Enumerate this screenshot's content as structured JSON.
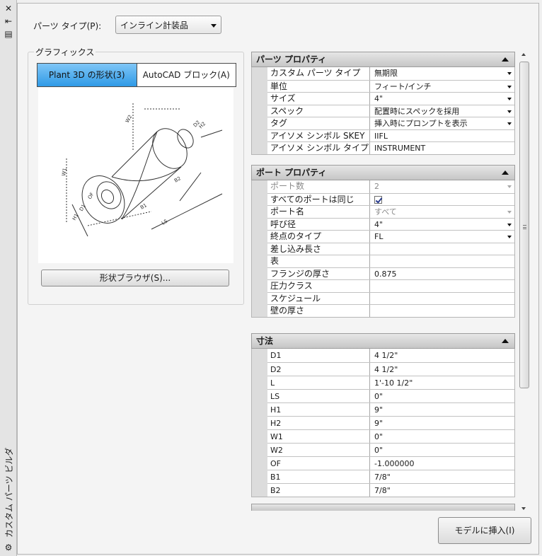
{
  "palette": {
    "title": "カスタム パーツ ビルダ"
  },
  "parts_type": {
    "label": "パーツ タイプ(P):",
    "value": "インライン計装品"
  },
  "graphics": {
    "group_title": "グラフィックス",
    "tabs": [
      {
        "label": "Plant 3D の形状(3)",
        "active": true
      },
      {
        "label": "AutoCAD ブロック(A)",
        "active": false
      }
    ],
    "browse_button": "形状ブラウザ(S)...",
    "diagram_labels": [
      "W2",
      "D2",
      "H2",
      "B2",
      "W1",
      "OF",
      "D1",
      "H1",
      "B1",
      "LS"
    ]
  },
  "sections": {
    "part_props": {
      "title": "パーツ プロパティ",
      "rows": [
        {
          "name": "カスタム パーツ タイプ",
          "value": "無期限"
        },
        {
          "name": "単位",
          "value": "フィート/インチ"
        },
        {
          "name": "サイズ",
          "value": "4\""
        },
        {
          "name": "スペック",
          "value": "配置時にスペックを採用"
        },
        {
          "name": "タグ",
          "value": "挿入時にプロンプトを表示"
        },
        {
          "name": "アイソメ シンボル SKEY",
          "value": "IIFL"
        },
        {
          "name": "アイソメ シンボル タイプ",
          "value": "INSTRUMENT"
        }
      ]
    },
    "port_props": {
      "title": "ポート プロパティ",
      "rows": [
        {
          "name": "ポート数",
          "value": "2"
        },
        {
          "name": "すべてのポートは同じ",
          "value": ""
        },
        {
          "name": "ポート名",
          "value": "すべて"
        },
        {
          "name": "呼び径",
          "value": "4\""
        },
        {
          "name": "終点のタイプ",
          "value": "FL"
        },
        {
          "name": "差し込み長さ",
          "value": ""
        },
        {
          "name": "表",
          "value": ""
        },
        {
          "name": "フランジの厚さ",
          "value": "0.875"
        },
        {
          "name": "圧力クラス",
          "value": ""
        },
        {
          "name": "スケジュール",
          "value": ""
        },
        {
          "name": "壁の厚さ",
          "value": ""
        }
      ]
    },
    "dimensions": {
      "title": "寸法",
      "rows": [
        {
          "name": "D1",
          "value": "4 1/2\""
        },
        {
          "name": "D2",
          "value": "4 1/2\""
        },
        {
          "name": "L",
          "value": "1'-10 1/2\""
        },
        {
          "name": "LS",
          "value": "0\""
        },
        {
          "name": "H1",
          "value": "9\""
        },
        {
          "name": "H2",
          "value": "9\""
        },
        {
          "name": "W1",
          "value": "0\""
        },
        {
          "name": "W2",
          "value": "0\""
        },
        {
          "name": "OF",
          "value": "-1.000000"
        },
        {
          "name": "B1",
          "value": "7/8\""
        },
        {
          "name": "B2",
          "value": "7/8\""
        }
      ]
    }
  },
  "insert_button": "モデルに挿入(I)",
  "colors": {
    "tab_active": "#2f9ae6",
    "section_header": "#c6c6c6"
  }
}
